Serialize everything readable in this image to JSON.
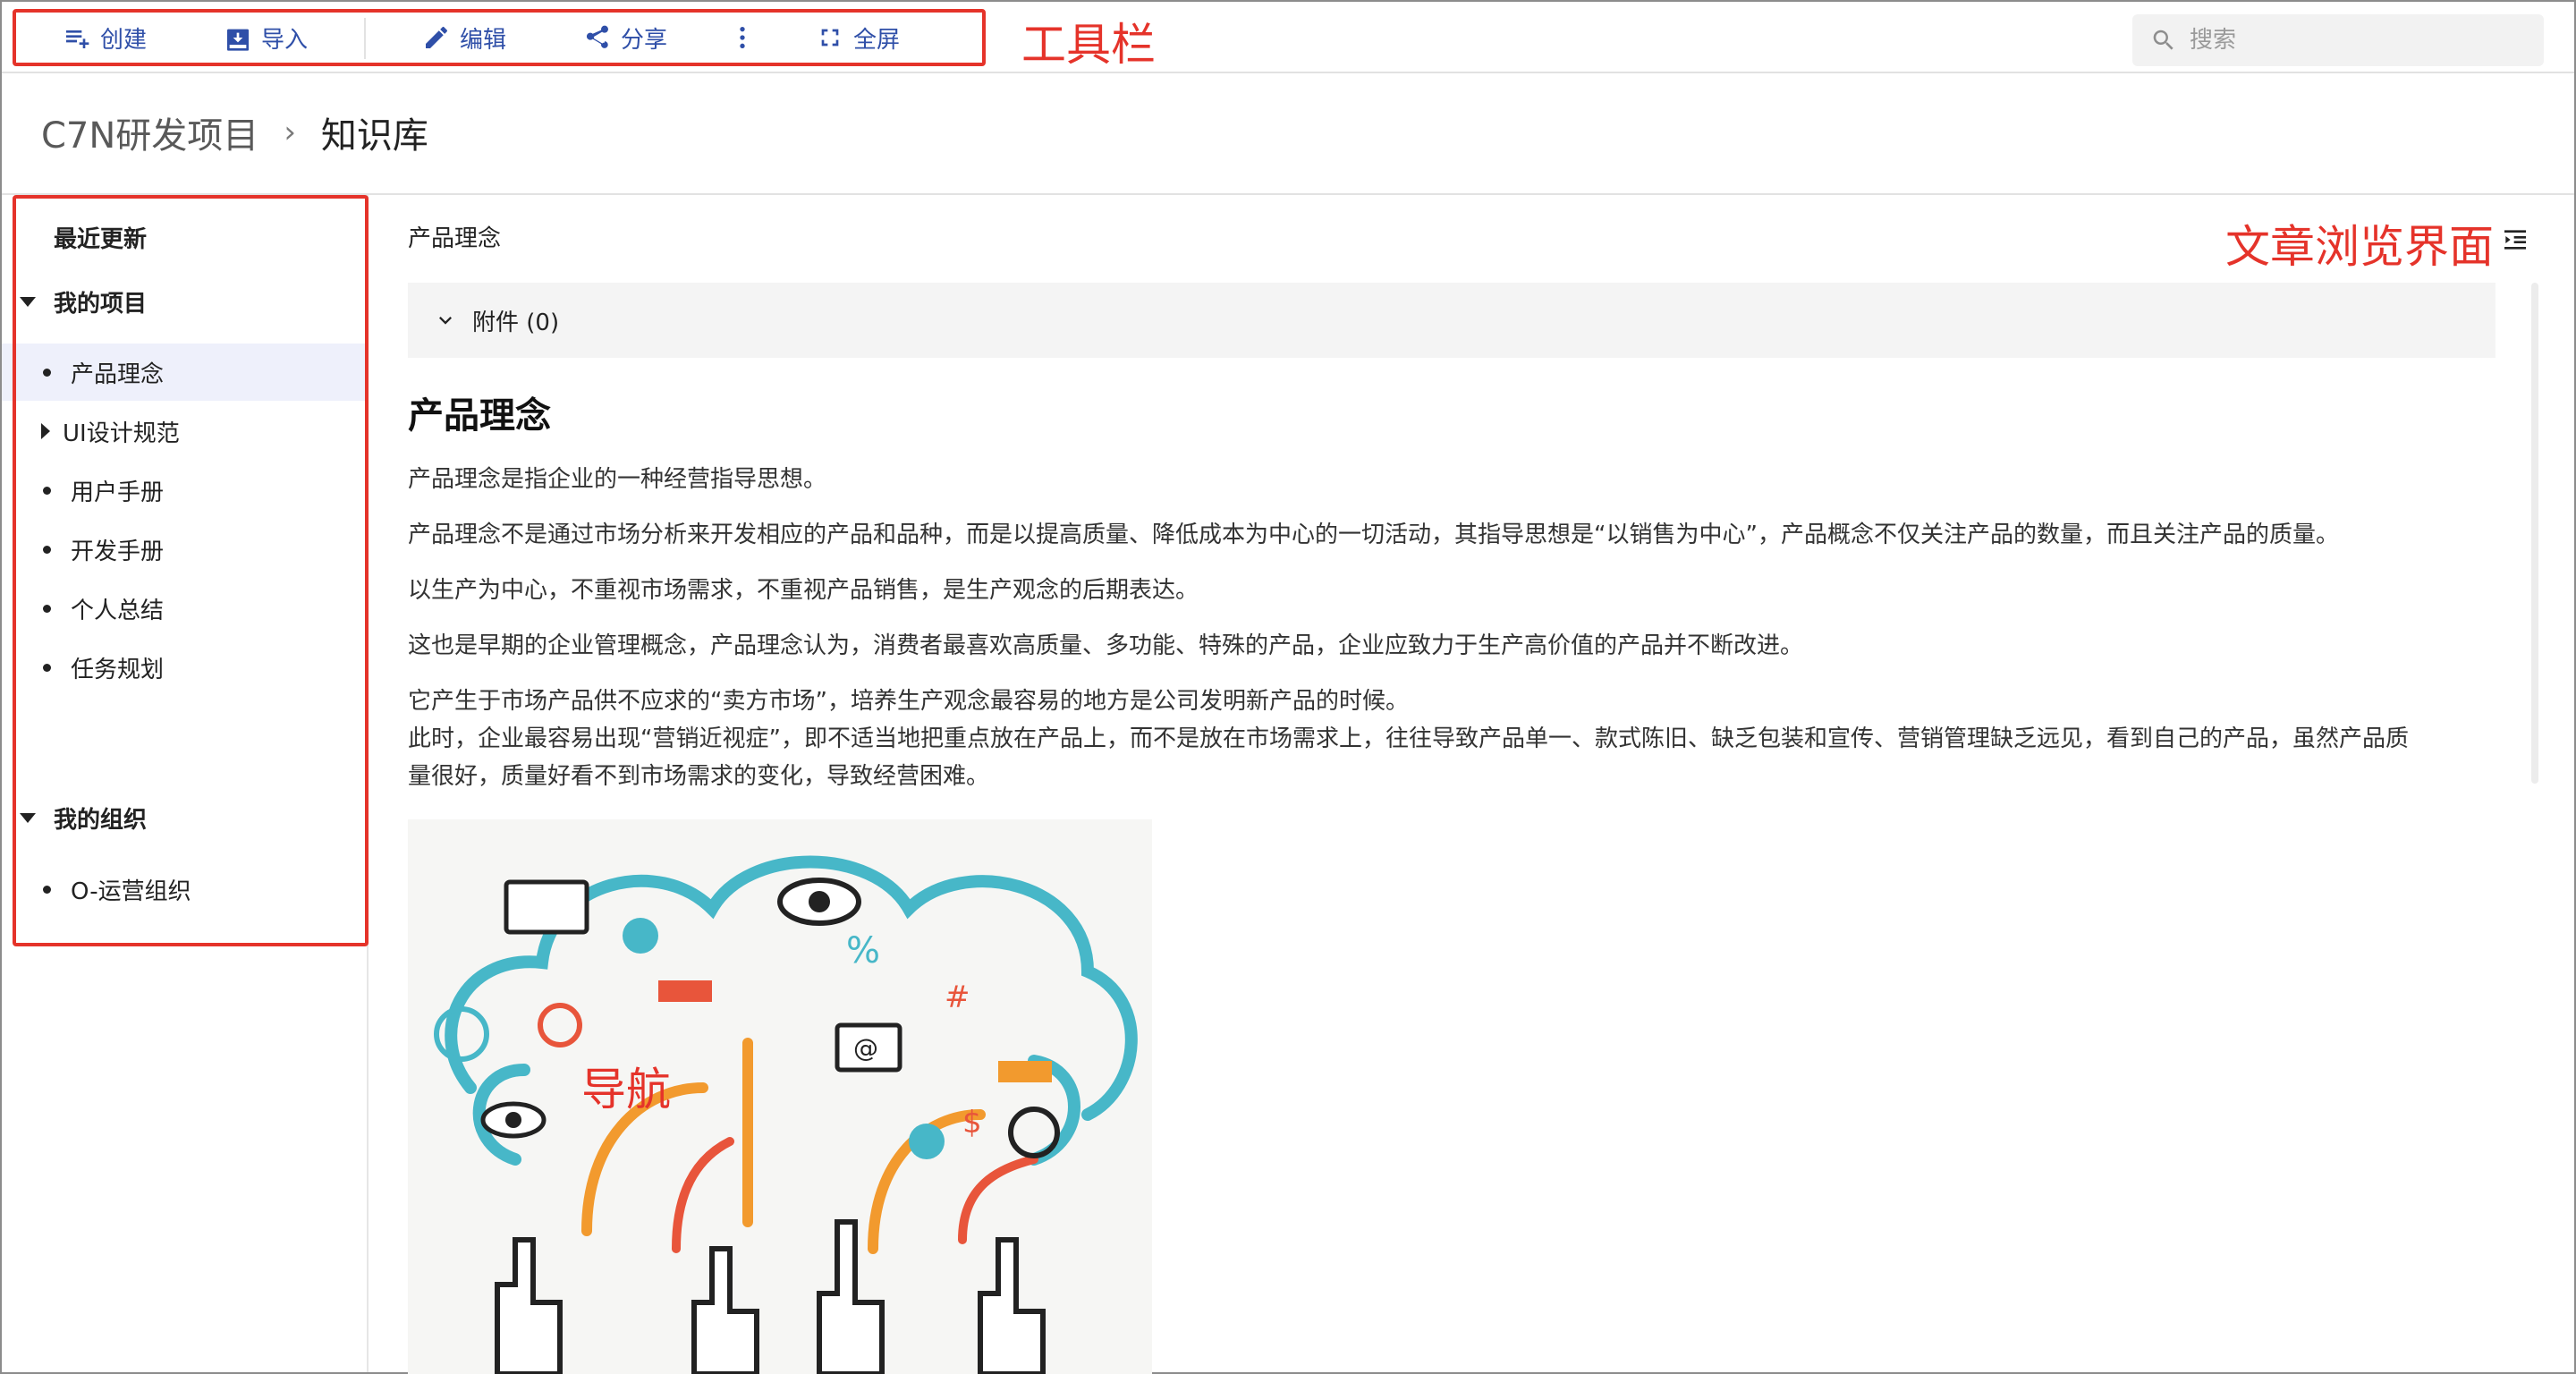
{
  "toolbar": {
    "create_label": "创建",
    "import_label": "导入",
    "edit_label": "编辑",
    "share_label": "分享",
    "fullscreen_label": "全屏"
  },
  "search": {
    "placeholder": "搜索"
  },
  "breadcrumb": {
    "project": "C7N研发项目",
    "current": "知识库"
  },
  "sidebar": {
    "recent": "最近更新",
    "my_projects": "我的项目",
    "project_items": [
      "产品理念",
      "UI设计规范",
      "用户手册",
      "开发手册",
      "个人总结",
      "任务规划"
    ],
    "my_orgs": "我的组织",
    "org_items": [
      "O-运营组织"
    ]
  },
  "content": {
    "page_title": "产品理念",
    "attachments_label": "附件 (0)",
    "heading": "产品理念",
    "paragraphs": [
      "产品理念是指企业的一种经营指导思想。",
      "产品理念不是通过市场分析来开发相应的产品和品种，而是以提高质量、降低成本为中心的一切活动，其指导思想是“以销售为中心”，产品概念不仅关注产品的数量，而且关注产品的质量。",
      "以生产为中心，不重视市场需求，不重视产品销售，是生产观念的后期表达。",
      "这也是早期的企业管理概念，产品理念认为，消费者最喜欢高质量、多功能、特殊的产品，企业应致力于生产高价值的产品并不断改进。",
      "它产生于市场产品供不应求的“卖方市场”，培养生产观念最容易的地方是公司发明新产品的时候。",
      "此时，企业最容易出现“营销近视症”，即不适当地把重点放在产品上，而不是放在市场需求上，往往导致产品单一、款式陈旧、缺乏包装和宣传、营销管理缺乏远见，看到自己的产品，虽然产品质",
      "量很好，质量好看不到市场需求的变化，导致经营困难。"
    ]
  },
  "annotations": {
    "toolbar": "工具栏",
    "article_view": "文章浏览界面",
    "navigation": "导航"
  },
  "colors": {
    "accent": "#2f4fa8",
    "annotation": "#e5332a",
    "active_bg": "#eef0fb"
  },
  "icons": [
    "create-icon",
    "import-icon",
    "edit-icon",
    "share-icon",
    "more-icon",
    "fullscreen-icon",
    "search-icon",
    "chevron-down-icon",
    "toc-icon"
  ]
}
